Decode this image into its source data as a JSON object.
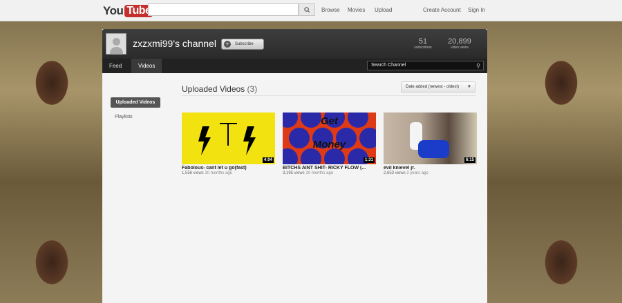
{
  "topbar": {
    "logo_you": "You",
    "logo_tube": "Tube",
    "search_value": "",
    "nav": [
      "Browse",
      "Movies",
      "Upload"
    ],
    "account": [
      "Create Account",
      "Sign In"
    ]
  },
  "channel": {
    "title": "zxzxmi99's channel",
    "subscribe_label": "Subscribe",
    "stats": [
      {
        "value": "51",
        "label": "subscribers"
      },
      {
        "value": "20,899",
        "label": "video views"
      }
    ],
    "tabs": [
      {
        "label": "Feed",
        "active": false
      },
      {
        "label": "Videos",
        "active": true
      }
    ],
    "search_placeholder": "Search Channel"
  },
  "sidebar": {
    "items": [
      {
        "label": "Uploaded Videos",
        "active": true
      },
      {
        "label": "Playlists",
        "active": false
      }
    ]
  },
  "main": {
    "section_title": "Uploaded Videos",
    "section_count": "(3)",
    "sort_label": "Date added (newest - oldest)",
    "videos": [
      {
        "title": "Fabolous- cant let u go(fast)",
        "views": "1,556 views",
        "age": "10 months ago",
        "duration": "4:04"
      },
      {
        "title": "BITCHS AINT SHIT- RICKY FLOW (...",
        "views": "3,195 views",
        "age": "10 months ago",
        "duration": "1:31",
        "thumb_text": [
          "Get",
          "Money"
        ]
      },
      {
        "title": "evil knievel jr.",
        "views": "2,653 views",
        "age": "2 years ago",
        "duration": "6:15"
      }
    ]
  },
  "icons": {
    "search": "magnifier-icon",
    "subscribe": "plus-icon",
    "sort": "caret-down-icon"
  }
}
